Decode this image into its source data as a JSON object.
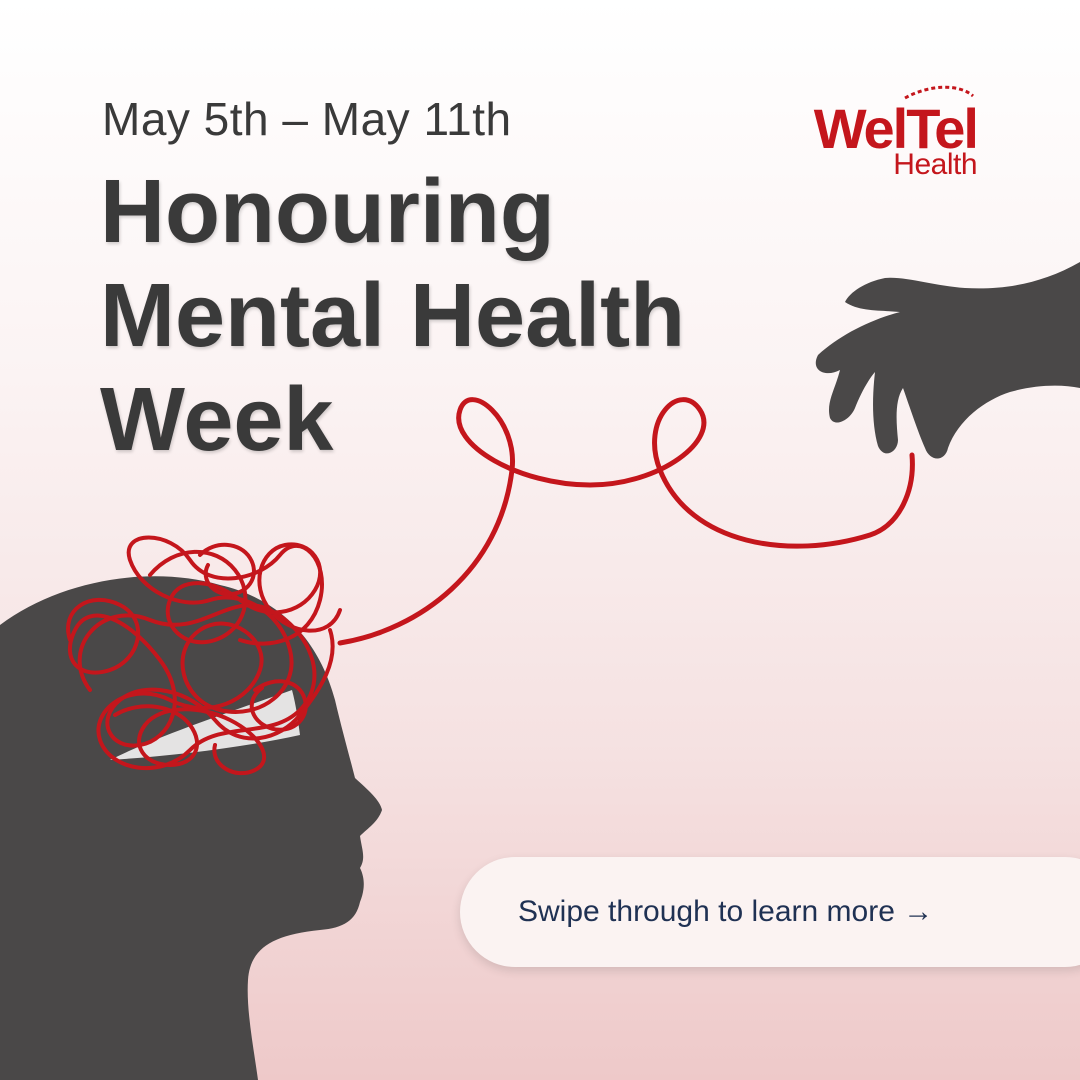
{
  "date_range": "May 5th – May 11th",
  "headline": {
    "line1": "Honouring",
    "line2": "Mental Health",
    "line3": "Week"
  },
  "logo": {
    "main": "WelTel",
    "sub": "Health"
  },
  "cta": {
    "label": "Swipe through to learn more →"
  },
  "colors": {
    "accent": "#c4161c",
    "silhouette": "#4a4848",
    "text": "#3a3a3a",
    "cta_text": "#1f3153"
  },
  "icons": [
    "head-silhouette",
    "hand-silhouette",
    "tangled-thread"
  ]
}
